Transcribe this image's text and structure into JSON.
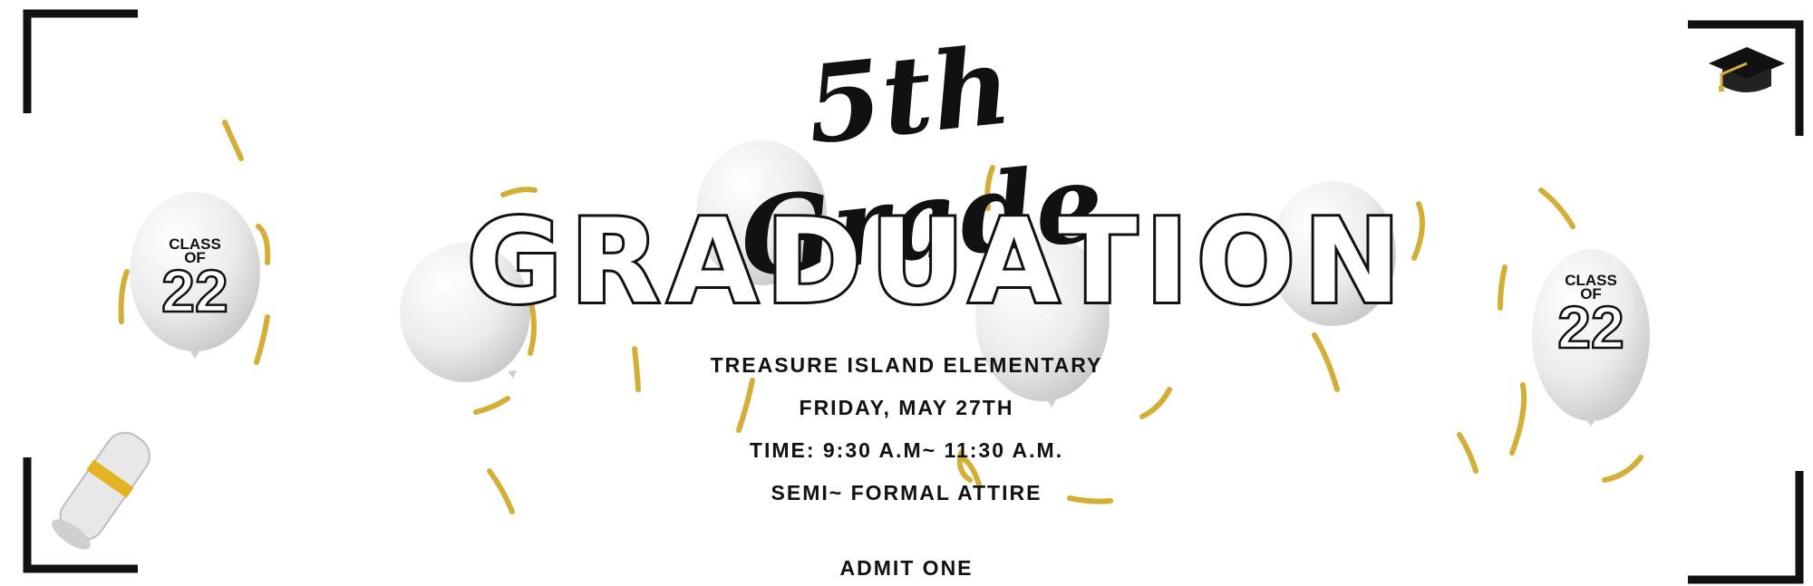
{
  "ticket": {
    "script_title": "5th Grade",
    "main_title": "GRADUATION",
    "school": "TREASURE ISLAND ELEMENTARY",
    "date": "FRIDAY, MAY 27TH",
    "time": "TIME: 9:30 A.M~ 11:30 A.M.",
    "attire": "SEMI~ FORMAL ATTIRE",
    "admit": "ADMIT ONE"
  },
  "balloon_left": {
    "line1": "CLASS",
    "line2": "OF",
    "line3": "22"
  },
  "balloon_right": {
    "line1": "CLASS",
    "line2": "OF",
    "line3": "22"
  },
  "decor": {
    "icons": [
      "graduation-cap-icon",
      "diploma-scroll-icon",
      "balloon-icon",
      "confetti-icon"
    ],
    "colors": {
      "text": "#111111",
      "gold": "#d4af37",
      "balloon": "#e9e9e9",
      "background": "#ffffff"
    }
  }
}
